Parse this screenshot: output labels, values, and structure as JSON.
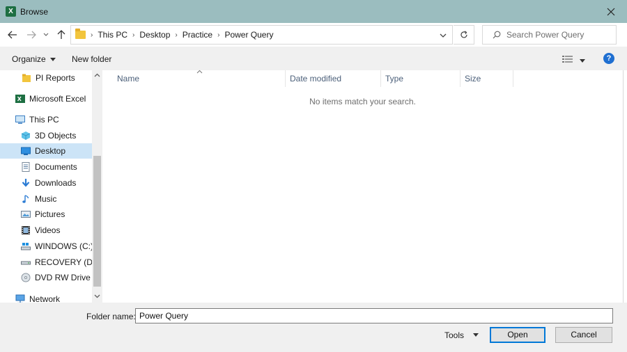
{
  "window": {
    "title": "Browse",
    "app_icon_letter": "X"
  },
  "address": {
    "crumbs": [
      "This PC",
      "Desktop",
      "Practice",
      "Power Query"
    ]
  },
  "search": {
    "placeholder": "Search Power Query"
  },
  "toolbar": {
    "organize_label": "Organize",
    "new_folder_label": "New folder"
  },
  "sidebar": {
    "items": [
      {
        "label": "PI Reports",
        "icon": "folder-icon"
      },
      {
        "label": "Microsoft Excel",
        "icon": "excel-icon"
      },
      {
        "label": "This PC",
        "icon": "computer-icon"
      },
      {
        "label": "3D Objects",
        "icon": "cube-icon"
      },
      {
        "label": "Desktop",
        "icon": "desktop-icon",
        "selected": true
      },
      {
        "label": "Documents",
        "icon": "documents-icon"
      },
      {
        "label": "Downloads",
        "icon": "download-icon"
      },
      {
        "label": "Music",
        "icon": "music-icon"
      },
      {
        "label": "Pictures",
        "icon": "pictures-icon"
      },
      {
        "label": "Videos",
        "icon": "videos-icon"
      },
      {
        "label": "WINDOWS (C:)",
        "icon": "drive-icon"
      },
      {
        "label": "RECOVERY (D:)",
        "icon": "drive-icon"
      },
      {
        "label": "DVD RW Drive (E",
        "icon": "dvd-icon"
      },
      {
        "label": "Network",
        "icon": "network-icon"
      }
    ]
  },
  "file_list": {
    "columns": [
      "Name",
      "Date modified",
      "Type",
      "Size"
    ],
    "empty_message": "No items match your search."
  },
  "footer": {
    "folder_name_label": "Folder name:",
    "folder_name_value": "Power Query",
    "tools_label": "Tools",
    "open_label": "Open",
    "cancel_label": "Cancel"
  },
  "colors": {
    "title_bar": "#9bbdbf",
    "selection": "#cce4f7",
    "accent": "#0078d7",
    "excel_green": "#1d6f42"
  }
}
